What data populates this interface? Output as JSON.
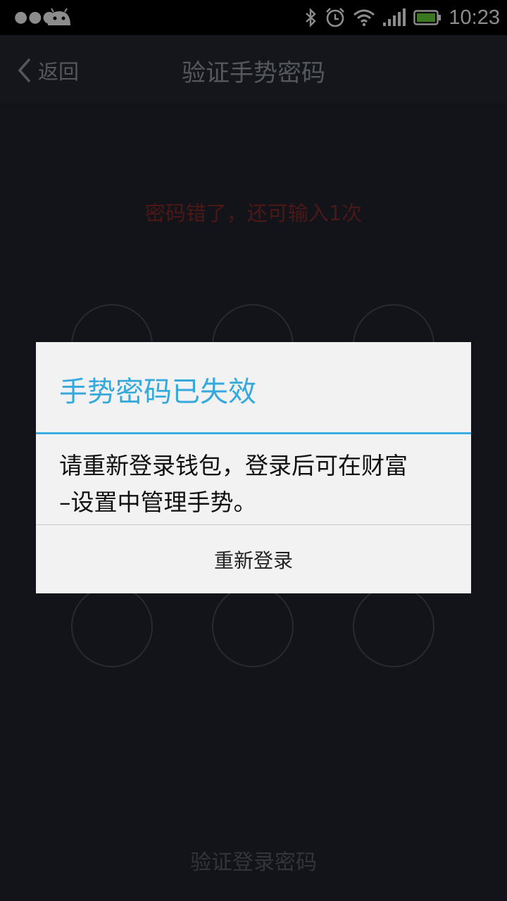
{
  "status_bar": {
    "time": "10:23",
    "left_icons": [
      "more-dots-icon",
      "android-icon"
    ],
    "right_icons": [
      "bluetooth-icon",
      "alarm-icon",
      "wifi-icon",
      "signal-icon",
      "battery-icon"
    ]
  },
  "header": {
    "back_label": "返回",
    "title": "验证手势密码"
  },
  "hint": "密码错了，还可输入1次",
  "bottom_link": "验证登录密码",
  "dialog": {
    "title": "手势密码已失效",
    "message_line1": "请重新登录钱包，登录后可在财富",
    "message_line2": "–设置中管理手势。",
    "button_label": "重新登录"
  },
  "colors": {
    "accent": "#35a9dc",
    "error": "#8a2a2a",
    "background": "#22252e"
  }
}
